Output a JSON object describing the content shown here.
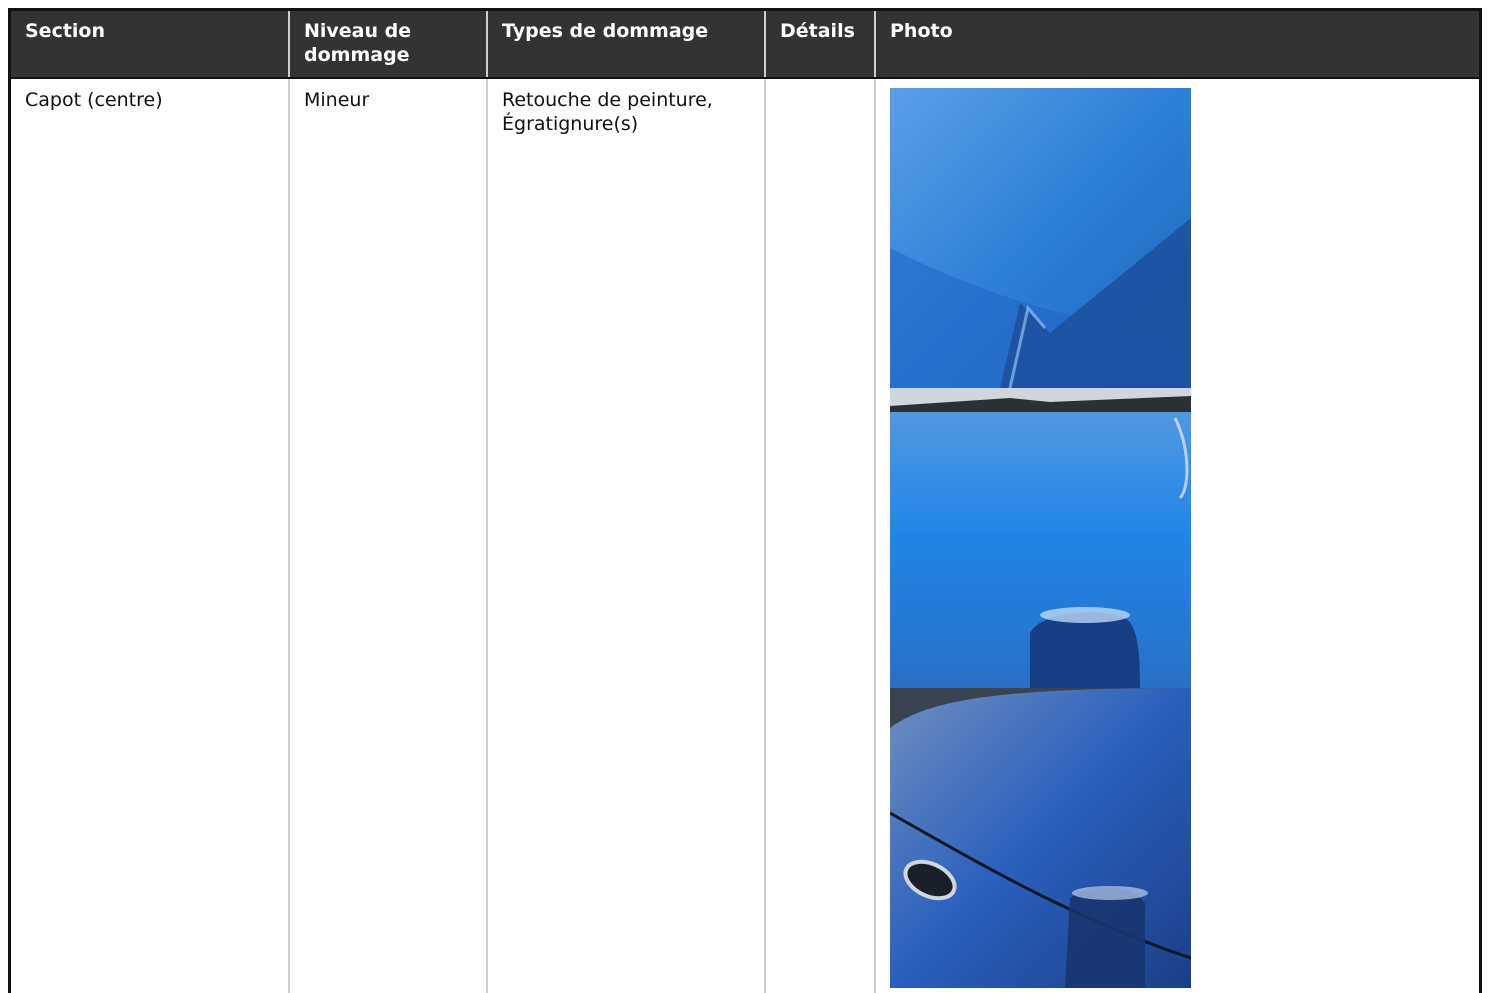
{
  "table": {
    "headers": {
      "section": "Section",
      "level": "Niveau de dommage",
      "types": "Types de dommage",
      "details": "Détails",
      "photo": "Photo"
    },
    "rows": [
      {
        "section": "Capot (centre)",
        "level": "Mineur",
        "types": "Retouche de peinture, Égratignure(s)",
        "details": "",
        "photos": [
          {
            "name": "hood-photo-1",
            "accent": "#2f7fd8"
          },
          {
            "name": "hood-photo-2",
            "accent": "#1f86e6"
          },
          {
            "name": "hood-photo-3",
            "accent": "#2a5fbe"
          }
        ]
      }
    ]
  }
}
